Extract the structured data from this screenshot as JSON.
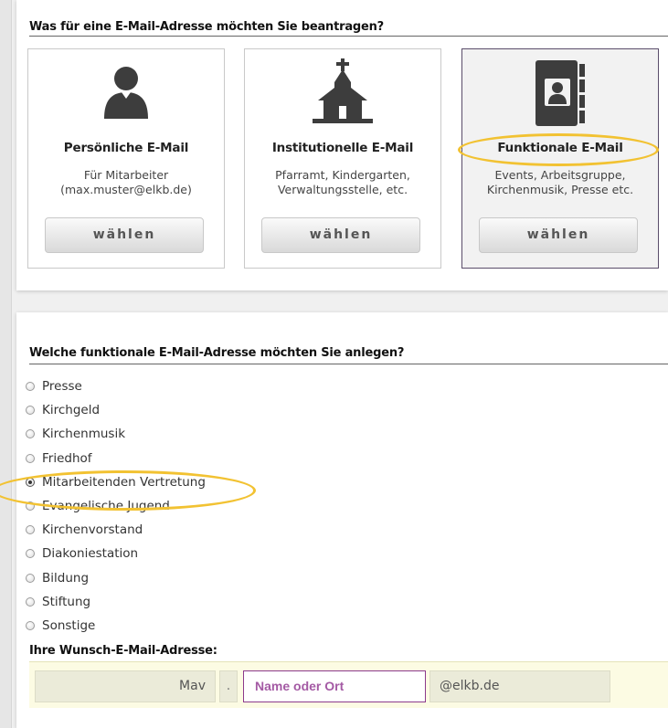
{
  "section1": {
    "heading": "Was für eine E-Mail-Adresse möchten Sie beantragen?"
  },
  "cards": [
    {
      "title": "Persönliche E-Mail",
      "desc1": "Für Mitarbeiter",
      "desc2": "(max.muster@elkb.de)",
      "button": "wählen",
      "icon": "person-icon"
    },
    {
      "title": "Institutionelle E-Mail",
      "desc1": "Pfarramt, Kindergarten,",
      "desc2": "Verwaltungsstelle, etc.",
      "button": "wählen",
      "icon": "church-icon"
    },
    {
      "title": "Funktionale E-Mail",
      "desc1": "Events, Arbeitsgruppe,",
      "desc2": "Kirchenmusik, Presse etc.",
      "button": "wählen",
      "icon": "address-book-icon",
      "selected": true
    }
  ],
  "section2": {
    "heading": "Welche funktionale E-Mail-Adresse möchten Sie anlegen?",
    "options": [
      "Presse",
      "Kirchgeld",
      "Kirchenmusik",
      "Friedhof",
      "Mitarbeitenden Vertretung",
      "Evangelische Jugend",
      "Kirchenvorstand",
      "Diakoniestation",
      "Bildung",
      "Stiftung",
      "Sonstige"
    ],
    "selected_option": "Mitarbeitenden Vertretung"
  },
  "wish": {
    "label": "Ihre Wunsch-E-Mail-Adresse:",
    "prefix": "Mav",
    "separator": ".",
    "placeholder": "Name oder Ort",
    "domain": "@elkb.de"
  },
  "colors": {
    "highlight": "#f2c232",
    "selected_border": "#5a4d6a",
    "input_border": "#8c3a8c",
    "input_bg": "#fcfbe3"
  }
}
